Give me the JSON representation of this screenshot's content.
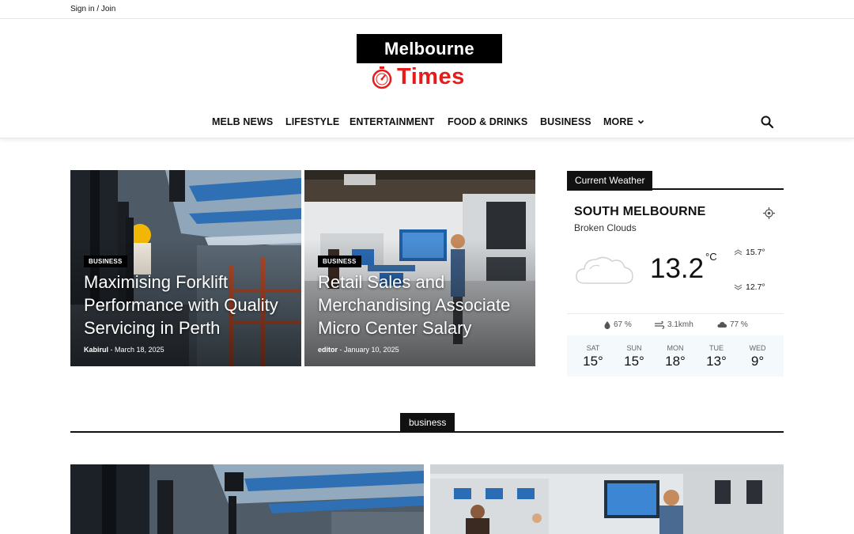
{
  "topbar": {
    "signin": "Sign in / Join"
  },
  "logo": {
    "line1": "Melbourne",
    "line2": "Times"
  },
  "nav": {
    "items": [
      "MELB NEWS",
      "LIFESTYLE",
      "ENTERTAINMENT",
      "FOOD & DRINKS",
      "BUSINESS",
      "MORE"
    ]
  },
  "featured": [
    {
      "category": "BUSINESS",
      "title": "Maximising Forklift Performance with Quality Servicing in Perth",
      "author": "Kabirul",
      "date": "March 18, 2025"
    },
    {
      "category": "BUSINESS",
      "title": "Retail Sales and Merchandising Associate Micro Center Salary",
      "author": "editor",
      "date": "January 10, 2025"
    }
  ],
  "weather": {
    "tab": "Current Weather",
    "city": "SOUTH MELBOURNE",
    "description": "Broken Clouds",
    "temp": "13.2",
    "unit": "°C",
    "high": "15.7°",
    "low": "12.7°",
    "humidity": "67 %",
    "wind": "3.1kmh",
    "clouds": "77 %",
    "forecast": [
      {
        "day": "SAT",
        "temp": "15°"
      },
      {
        "day": "SUN",
        "temp": "15°"
      },
      {
        "day": "MON",
        "temp": "18°"
      },
      {
        "day": "TUE",
        "temp": "13°"
      },
      {
        "day": "WED",
        "temp": "9°"
      }
    ]
  },
  "section": {
    "title": "business"
  }
}
